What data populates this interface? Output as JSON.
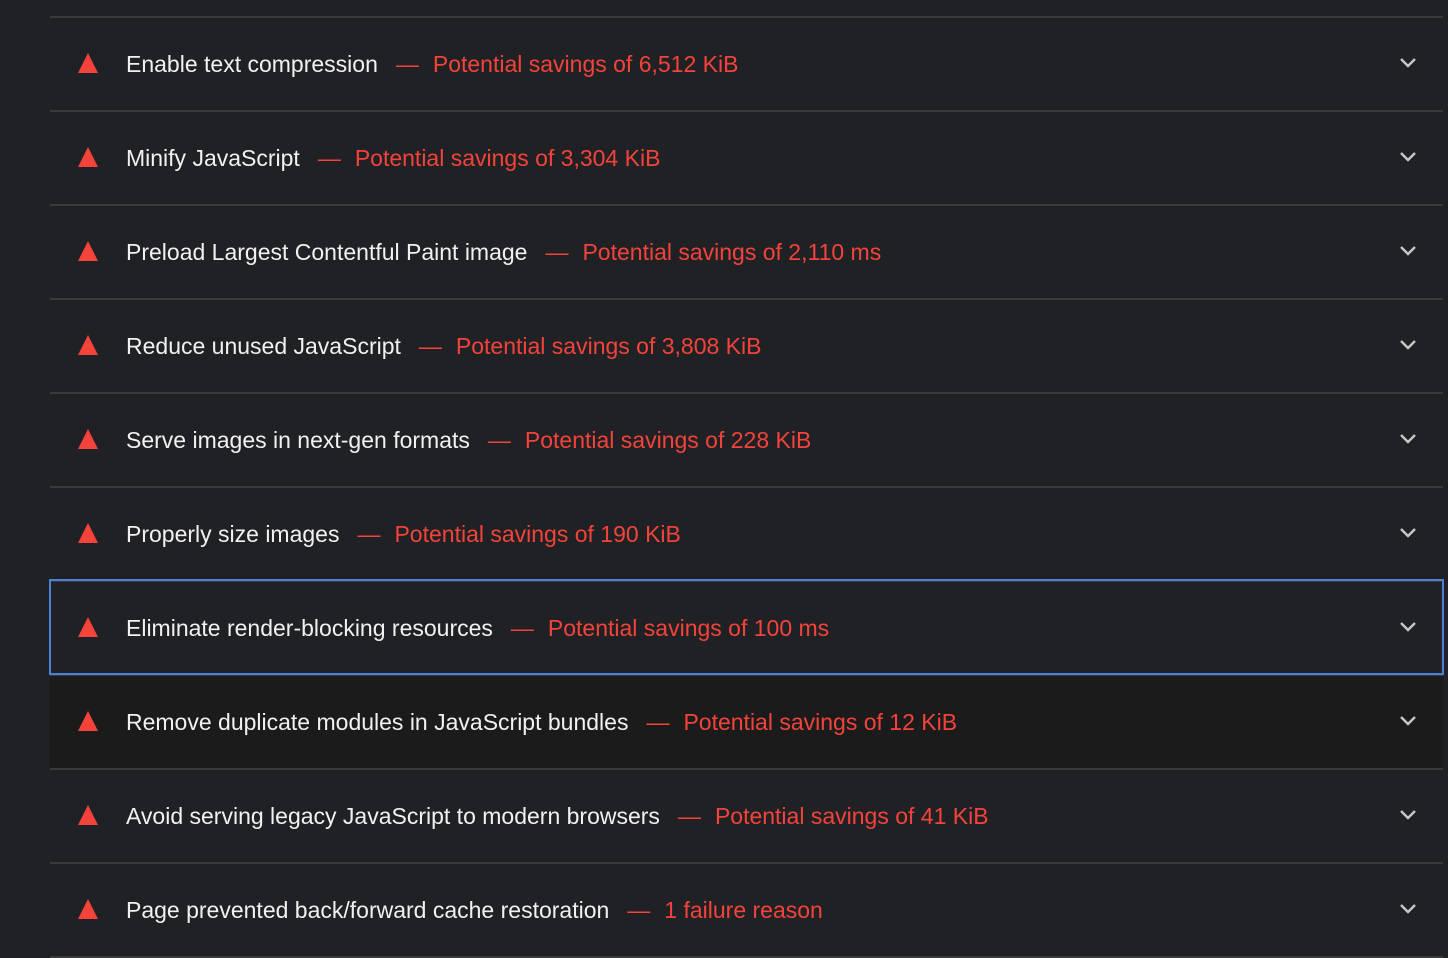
{
  "audits": [
    {
      "title": "Enable text compression",
      "separator": "—",
      "display_value": "Potential savings of 6,512 KiB"
    },
    {
      "title": "Minify JavaScript",
      "separator": "—",
      "display_value": "Potential savings of 3,304 KiB"
    },
    {
      "title": "Preload Largest Contentful Paint image",
      "separator": "—",
      "display_value": "Potential savings of 2,110 ms"
    },
    {
      "title": "Reduce unused JavaScript",
      "separator": "—",
      "display_value": "Potential savings of 3,808 KiB"
    },
    {
      "title": "Serve images in next-gen formats",
      "separator": "—",
      "display_value": "Potential savings of 228 KiB"
    },
    {
      "title": "Properly size images",
      "separator": "—",
      "display_value": "Potential savings of 190 KiB"
    },
    {
      "title": "Eliminate render-blocking resources",
      "separator": "—",
      "display_value": "Potential savings of 100 ms"
    },
    {
      "title": "Remove duplicate modules in JavaScript bundles",
      "separator": "—",
      "display_value": "Potential savings of 12 KiB"
    },
    {
      "title": "Avoid serving legacy JavaScript to modern browsers",
      "separator": "—",
      "display_value": "Potential savings of 41 KiB"
    },
    {
      "title": "Page prevented back/forward cache restoration",
      "separator": "—",
      "display_value": "1 failure reason"
    }
  ],
  "icons": {
    "status": "fail-triangle-icon",
    "expand": "chevron-down-icon"
  },
  "colors": {
    "background": "#202124",
    "fail": "#f4433b",
    "text": "#f1f1f1",
    "divider": "#3a3a3a",
    "focus": "#4a80d8"
  }
}
